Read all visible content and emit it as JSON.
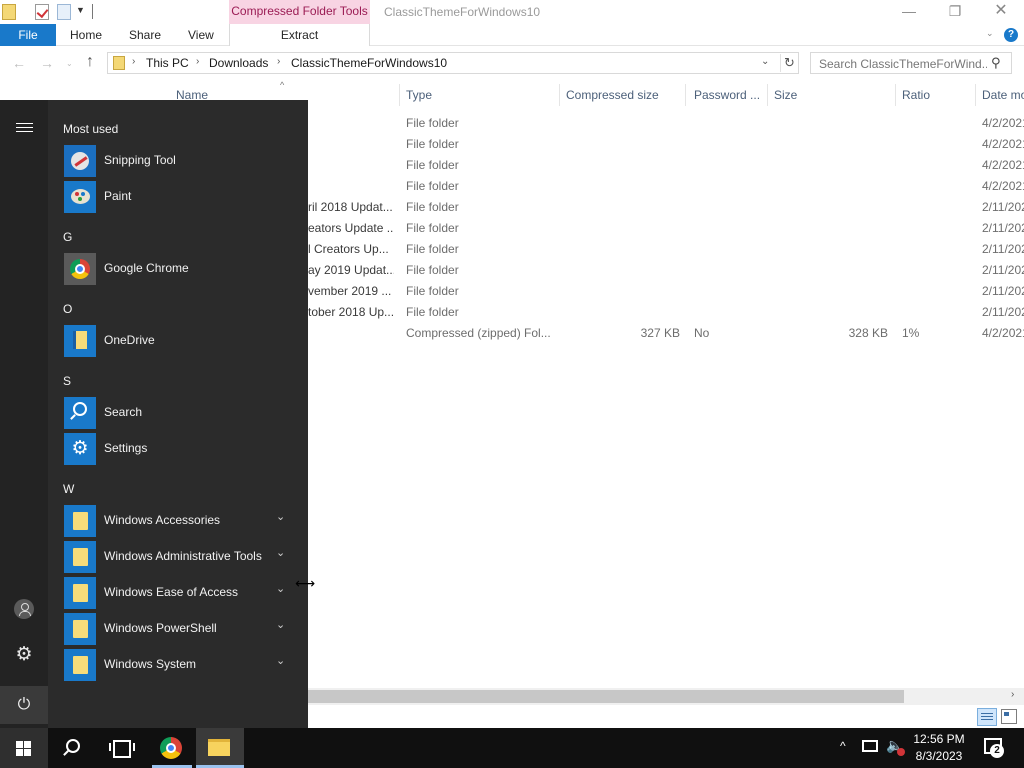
{
  "window": {
    "title": "ClassicThemeForWindows10",
    "contextual_tab_group": "Compressed Folder Tools",
    "minimize": "—",
    "maximize": "❐",
    "close": "✕"
  },
  "ribbon": {
    "tabs": {
      "file": "File",
      "home": "Home",
      "share": "Share",
      "view": "View",
      "extract": "Extract"
    },
    "help": "?"
  },
  "address": {
    "breadcrumb": [
      "This PC",
      "Downloads",
      "ClassicThemeForWindows10"
    ],
    "separator": "›"
  },
  "search": {
    "placeholder": "Search ClassicThemeForWind..."
  },
  "columns": {
    "name": "Name",
    "type": "Type",
    "compressed_size": "Compressed size",
    "password": "Password ...",
    "size": "Size",
    "ratio": "Ratio",
    "date": "Date mo"
  },
  "files": [
    {
      "name": "",
      "type": "File folder",
      "compressed_size": "",
      "password": "",
      "size": "",
      "ratio": "",
      "date": "4/2/2021"
    },
    {
      "name": "",
      "type": "File folder",
      "compressed_size": "",
      "password": "",
      "size": "",
      "ratio": "",
      "date": "4/2/2021"
    },
    {
      "name": "",
      "type": "File folder",
      "compressed_size": "",
      "password": "",
      "size": "",
      "ratio": "",
      "date": "4/2/2021"
    },
    {
      "name": "",
      "type": "File folder",
      "compressed_size": "",
      "password": "",
      "size": "",
      "ratio": "",
      "date": "4/2/2021"
    },
    {
      "name": "ril 2018 Updat...",
      "type": "File folder",
      "compressed_size": "",
      "password": "",
      "size": "",
      "ratio": "",
      "date": "2/11/202"
    },
    {
      "name": "eators Update ...",
      "type": "File folder",
      "compressed_size": "",
      "password": "",
      "size": "",
      "ratio": "",
      "date": "2/11/202"
    },
    {
      "name": "l Creators Up...",
      "type": "File folder",
      "compressed_size": "",
      "password": "",
      "size": "",
      "ratio": "",
      "date": "2/11/202"
    },
    {
      "name": "ay 2019 Updat...",
      "type": "File folder",
      "compressed_size": "",
      "password": "",
      "size": "",
      "ratio": "",
      "date": "2/11/202"
    },
    {
      "name": "vember 2019 ...",
      "type": "File folder",
      "compressed_size": "",
      "password": "",
      "size": "",
      "ratio": "",
      "date": "2/11/202"
    },
    {
      "name": "tober 2018 Up...",
      "type": "File folder",
      "compressed_size": "",
      "password": "",
      "size": "",
      "ratio": "",
      "date": "2/11/202"
    },
    {
      "name": "",
      "type": "Compressed (zipped) Fol...",
      "compressed_size": "327 KB",
      "password": "No",
      "size": "328 KB",
      "ratio": "1%",
      "date": "4/2/2021"
    }
  ],
  "start_menu": {
    "most_used_label": "Most used",
    "most_used": [
      {
        "label": "Snipping Tool",
        "icon": "snipping-tool-icon"
      },
      {
        "label": "Paint",
        "icon": "paint-icon"
      }
    ],
    "groups": [
      {
        "letter": "G",
        "items": [
          {
            "label": "Google Chrome",
            "icon": "chrome-icon"
          }
        ]
      },
      {
        "letter": "O",
        "items": [
          {
            "label": "OneDrive",
            "icon": "onedrive-icon"
          }
        ]
      },
      {
        "letter": "S",
        "items": [
          {
            "label": "Search",
            "icon": "search-icon"
          },
          {
            "label": "Settings",
            "icon": "gear-icon"
          }
        ]
      },
      {
        "letter": "W",
        "items": [
          {
            "label": "Windows Accessories",
            "icon": "folder-icon"
          },
          {
            "label": "Windows Administrative Tools",
            "icon": "folder-icon"
          },
          {
            "label": "Windows Ease of Access",
            "icon": "folder-icon"
          },
          {
            "label": "Windows PowerShell",
            "icon": "folder-icon"
          },
          {
            "label": "Windows System",
            "icon": "folder-icon"
          }
        ]
      }
    ],
    "chevron": "⌄",
    "power_glyph": "⏻",
    "settings_glyph": "⚙"
  },
  "taskbar": {
    "time": "12:56 PM",
    "date": "8/3/2023",
    "notification_count": "2",
    "tray_chevron": "^"
  },
  "colors": {
    "accent": "#1979ca",
    "start_bg": "#2b2b2b",
    "taskbar_bg": "#101010",
    "contextual_tab": "#f8d4e3"
  }
}
